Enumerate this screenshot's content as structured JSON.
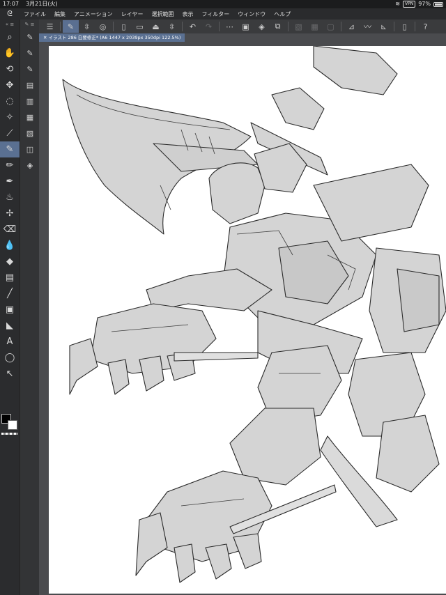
{
  "status": {
    "time": "17:07",
    "date": "3月21日(火)",
    "vpn": "VPN",
    "battery": "97%"
  },
  "menu": [
    "ファイル",
    "編集",
    "アニメーション",
    "レイヤー",
    "選択範囲",
    "表示",
    "フィルター",
    "ウィンドウ",
    "ヘルプ"
  ],
  "document": {
    "tab_label": "✕ イラスト 286 白要修正* (A6 1447 x 2039px 350dpi 122.5%)"
  },
  "toolbar": [
    {
      "name": "menu-icon",
      "glyph": "☰"
    },
    {
      "name": "sep"
    },
    {
      "name": "pen-mode-icon",
      "glyph": "✎",
      "active": true
    },
    {
      "name": "chevron-updown-icon",
      "glyph": "⇳"
    },
    {
      "name": "view-icon",
      "glyph": "◎"
    },
    {
      "name": "sep"
    },
    {
      "name": "new-file-icon",
      "glyph": "▯"
    },
    {
      "name": "open-folder-icon",
      "glyph": "▭"
    },
    {
      "name": "save-icon",
      "glyph": "⏏"
    },
    {
      "name": "chevron-icon",
      "glyph": "⇳"
    },
    {
      "name": "sep"
    },
    {
      "name": "undo-icon",
      "glyph": "↶"
    },
    {
      "name": "redo-icon",
      "glyph": "↷",
      "dim": true
    },
    {
      "name": "sep"
    },
    {
      "name": "deselect-icon",
      "glyph": "⋯"
    },
    {
      "name": "invert-selection-icon",
      "glyph": "▣"
    },
    {
      "name": "fill-icon",
      "glyph": "◈"
    },
    {
      "name": "transform-icon",
      "glyph": "⧉"
    },
    {
      "name": "sep"
    },
    {
      "name": "clear-icon",
      "glyph": "▧",
      "dim": true
    },
    {
      "name": "crop-icon",
      "glyph": "▦",
      "dim": true
    },
    {
      "name": "select-icon",
      "glyph": "▢",
      "dim": true
    },
    {
      "name": "sep"
    },
    {
      "name": "ruler-icon",
      "glyph": "⊿"
    },
    {
      "name": "brush-stroke-icon",
      "glyph": "〰"
    },
    {
      "name": "line-ruler-icon",
      "glyph": "⊾"
    },
    {
      "name": "sep"
    },
    {
      "name": "device-icon",
      "glyph": "▯"
    },
    {
      "name": "sep"
    },
    {
      "name": "help-icon",
      "glyph": "?"
    }
  ],
  "tools": [
    {
      "name": "zoom-tool-icon",
      "glyph": "⌕"
    },
    {
      "name": "hand-tool-icon",
      "glyph": "✋"
    },
    {
      "name": "rotate-tool-icon",
      "glyph": "⟲"
    },
    {
      "name": "move-tool-icon",
      "glyph": "✥"
    },
    {
      "name": "lasso-tool-icon",
      "glyph": "◌"
    },
    {
      "name": "magic-wand-icon",
      "glyph": "✧"
    },
    {
      "name": "eyedropper-icon",
      "glyph": "⟋"
    },
    {
      "name": "pen-tool-icon",
      "glyph": "✎",
      "active": true
    },
    {
      "name": "pencil-tool-icon",
      "glyph": "✏"
    },
    {
      "name": "brush-tool-icon",
      "glyph": "✒"
    },
    {
      "name": "airbrush-icon",
      "glyph": "♨"
    },
    {
      "name": "decoration-icon",
      "glyph": "✢"
    },
    {
      "name": "eraser-icon",
      "glyph": "⌫"
    },
    {
      "name": "blend-icon",
      "glyph": "💧"
    },
    {
      "name": "fill-tool-icon",
      "glyph": "◆"
    },
    {
      "name": "gradient-icon",
      "glyph": "▤"
    },
    {
      "name": "line-tool-icon",
      "glyph": "╱"
    },
    {
      "name": "frame-icon",
      "glyph": "▣"
    },
    {
      "name": "figure-icon",
      "glyph": "◣"
    },
    {
      "name": "text-tool-icon",
      "glyph": "A"
    },
    {
      "name": "balloon-icon",
      "glyph": "◯"
    },
    {
      "name": "correct-line-icon",
      "glyph": "↖"
    }
  ],
  "subtools": [
    {
      "name": "sub-pen-1-icon",
      "glyph": "✎"
    },
    {
      "name": "sub-pen-2-icon",
      "glyph": "✎"
    },
    {
      "name": "sub-pen-3-icon",
      "glyph": "✎"
    },
    {
      "name": "sub-layer-icon",
      "glyph": "▤"
    },
    {
      "name": "sub-layer-2-icon",
      "glyph": "▥"
    },
    {
      "name": "sub-panel-icon",
      "glyph": "▦"
    },
    {
      "name": "sub-panel-2-icon",
      "glyph": "▧"
    },
    {
      "name": "sub-stack-icon",
      "glyph": "◫"
    },
    {
      "name": "sub-layers-icon",
      "glyph": "◈"
    }
  ],
  "colors": {
    "main": "#000000",
    "sub": "#ffffff",
    "accent": "#5a7092"
  }
}
